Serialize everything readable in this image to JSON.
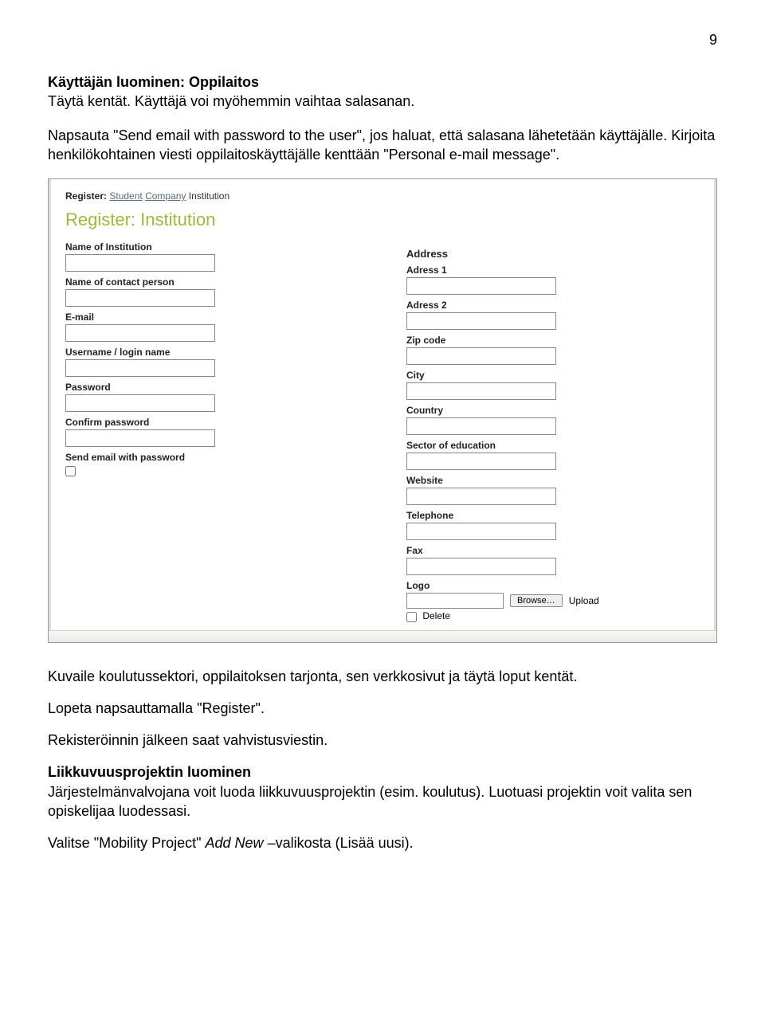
{
  "page_number": "9",
  "doc": {
    "section_title": "Käyttäjän luominen: Oppilaitos",
    "intro_line": "Täytä kentät. Käyttäjä voi myöhemmin vaihtaa salasanan.",
    "para2": "Napsauta \"Send email with password to the user\", jos haluat, että salasana lähetetään käyttäjälle. Kirjoita henkilökohtainen viesti oppilaitoskäyttäjälle kenttään \"Personal e-mail message\".",
    "after1": "Kuvaile koulutussektori, oppilaitoksen tarjonta, sen verkkosivut ja täytä loput kentät.",
    "after2": "Lopeta napsauttamalla \"Register\".",
    "after3": "Rekisteröinnin jälkeen saat vahvistusviestin.",
    "after4_title": "Liikkuvuusprojektin luominen",
    "after4_body": "Järjestelmänvalvojana voit luoda liikkuvuusprojektin (esim. koulutus). Luotuasi projektin voit valita sen opiskelijaa luodessasi.",
    "after5_a": "Valitse \"Mobility Project\" ",
    "after5_ital": "Add New",
    "after5_b": " –valikosta (Lisää uusi)."
  },
  "form": {
    "nav_label": "Register:",
    "nav_student": "Student",
    "nav_company": "Company",
    "nav_institution": "Institution",
    "heading": "Register: Institution",
    "left": {
      "name_institution": "Name of Institution",
      "contact_person": "Name of contact person",
      "email": "E-mail",
      "username": "Username / login name",
      "password": "Password",
      "confirm_password": "Confirm password",
      "send_email": "Send email with password"
    },
    "right": {
      "address": "Address",
      "address1": "Adress 1",
      "address2": "Adress 2",
      "zip": "Zip code",
      "city": "City",
      "country": "Country",
      "sector": "Sector of education",
      "website": "Website",
      "telephone": "Telephone",
      "fax": "Fax",
      "logo": "Logo",
      "browse": "Browse…",
      "upload": "Upload",
      "delete": "Delete"
    }
  }
}
